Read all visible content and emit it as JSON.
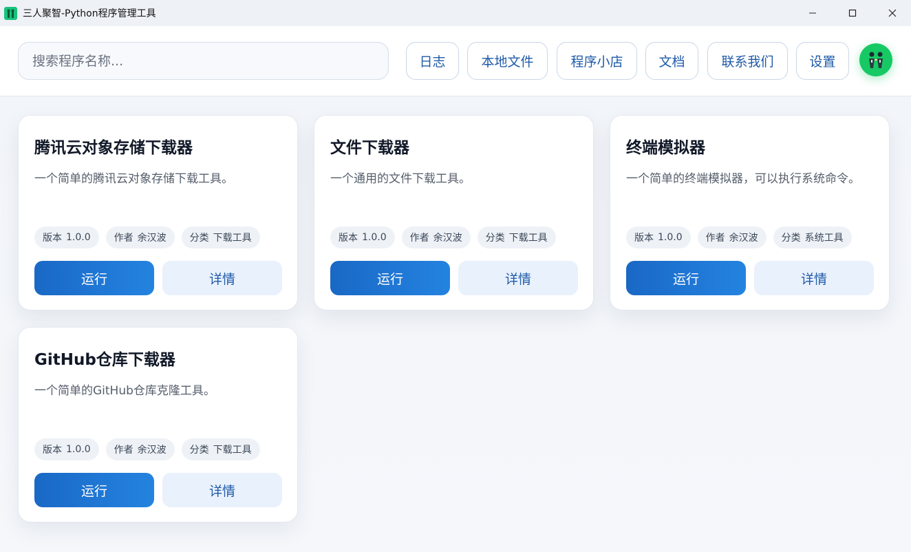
{
  "window": {
    "title": "三人聚智-Python程序管理工具",
    "icon": "app-logo-icon",
    "controls": [
      "minimize-icon",
      "maximize-icon",
      "close-icon"
    ]
  },
  "header": {
    "search_placeholder": "搜索程序名称...",
    "nav": [
      {
        "label": "日志"
      },
      {
        "label": "本地文件"
      },
      {
        "label": "程序小店"
      },
      {
        "label": "文档"
      },
      {
        "label": "联系我们"
      },
      {
        "label": "设置"
      }
    ],
    "avatar_icon": "user-avatar-icon"
  },
  "colors": {
    "accent": "#1e5aa8",
    "run_gradient_start": "#1a68c6",
    "run_gradient_end": "#2483e0",
    "avatar_bg": "#17c964"
  },
  "programs": [
    {
      "title": "腾讯云对象存储下载器",
      "description": "一个简单的腾讯云对象存储下载工具。",
      "version_key": "版本",
      "version": "1.0.0",
      "author_key": "作者",
      "author": "余汉波",
      "category_key": "分类",
      "category": "下载工具",
      "run_label": "运行",
      "detail_label": "详情"
    },
    {
      "title": "文件下载器",
      "description": "一个通用的文件下载工具。",
      "version_key": "版本",
      "version": "1.0.0",
      "author_key": "作者",
      "author": "余汉波",
      "category_key": "分类",
      "category": "下载工具",
      "run_label": "运行",
      "detail_label": "详情"
    },
    {
      "title": "终端模拟器",
      "description": "一个简单的终端模拟器，可以执行系统命令。",
      "version_key": "版本",
      "version": "1.0.0",
      "author_key": "作者",
      "author": "余汉波",
      "category_key": "分类",
      "category": "系统工具",
      "run_label": "运行",
      "detail_label": "详情"
    },
    {
      "title": "GitHub仓库下载器",
      "description": "一个简单的GitHub仓库克隆工具。",
      "version_key": "版本",
      "version": "1.0.0",
      "author_key": "作者",
      "author": "余汉波",
      "category_key": "分类",
      "category": "下载工具",
      "run_label": "运行",
      "detail_label": "详情"
    }
  ]
}
